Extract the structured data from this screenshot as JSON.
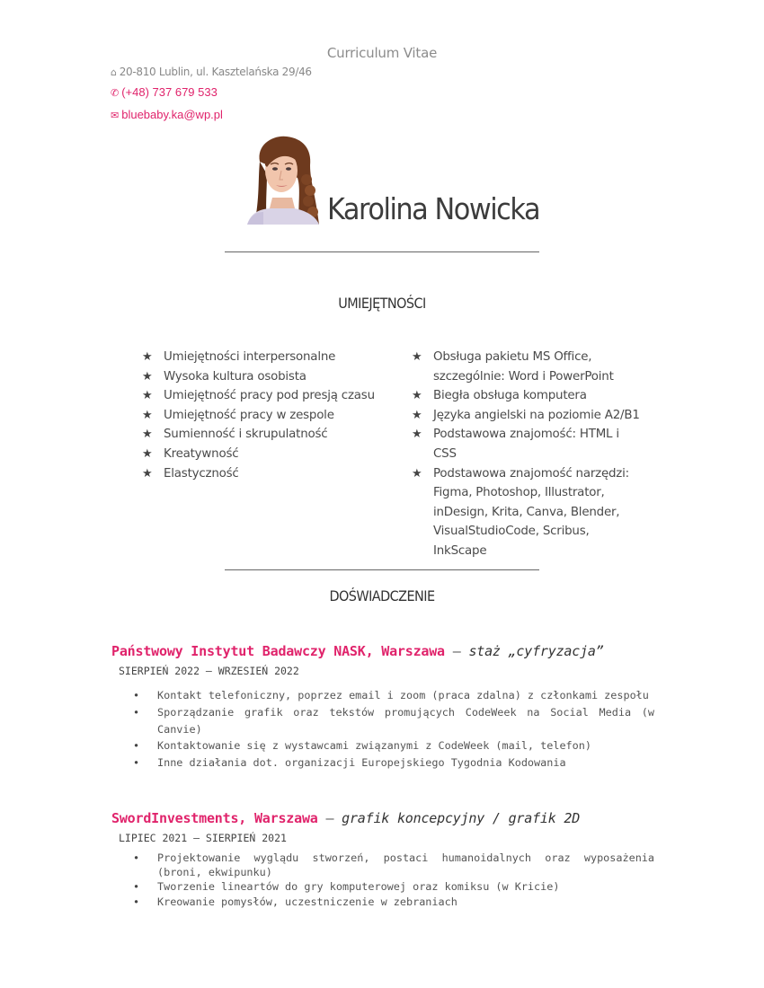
{
  "document": {
    "title": "Curriculum Vitae"
  },
  "contact": {
    "address": "20-810 Lublin, ul. Kasztelańska 29/46",
    "phone": "(+48) 737 679 533",
    "email": "bluebaby.ka@wp.pl",
    "address_icon": "house-icon",
    "phone_icon": "phone-icon",
    "email_icon": "envelope-icon"
  },
  "profile": {
    "name": "Karolina Nowicka"
  },
  "skills": {
    "heading": "UMIEJĘTNOŚCI",
    "left": [
      "Umiejętności interpersonalne",
      "Wysoka kultura osobista",
      "Umiejętność pracy pod presją czasu",
      "Umiejętność pracy w zespole",
      "Sumienność i skrupulatność",
      "Kreatywność",
      "Elastyczność"
    ],
    "right": [
      "Obsługa pakietu MS Office, szczególnie: Word i PowerPoint",
      "Biegła obsługa komputera",
      "Języka angielski na poziomie A2/B1",
      "Podstawowa znajomość: HTML i CSS",
      "Podstawowa znajomość narzędzi: Figma, Photoshop, Illustrator, inDesign, Krita, Canva, Blender, VisualStudioCode, Scribus, InkScape"
    ]
  },
  "experience": {
    "heading": "DOŚWIADCZENIE",
    "jobs": [
      {
        "company": "Państwowy Instytut Badawczy NASK, Warszawa",
        "dash": "—",
        "role": "staż „cyfryzacja”",
        "dates": "SIERPIEŃ 2022 – WRZESIEŃ 2022",
        "duties": [
          "Kontakt telefoniczny, poprzez email i zoom (praca zdalna) z członkami zespołu",
          "Sporządzanie grafik oraz tekstów promujących CodeWeek na Social Media (w Canvie)",
          "Kontaktowanie się z wystawcami związanymi z CodeWeek (mail, telefon)",
          "Inne działania dot. organizacji Europejskiego Tygodnia Kodowania"
        ]
      },
      {
        "company": "SwordInvestments, Warszawa",
        "dash": "—",
        "role": "grafik koncepcyjny / grafik 2D",
        "dates": "LIPIEC 2021 – SIERPIEŃ 2021",
        "duties": [
          "Projektowanie wyglądu stworzeń, postaci humanoidalnych oraz wyposażenia (broni, ekwipunku)",
          "Tworzenie lineartów do gry komputerowej oraz komiksu (w Kricie)",
          "Kreowanie pomysłów, uczestniczenie w zebraniach"
        ]
      }
    ]
  },
  "colors": {
    "accent": "#e0236b",
    "text": "#444444"
  }
}
